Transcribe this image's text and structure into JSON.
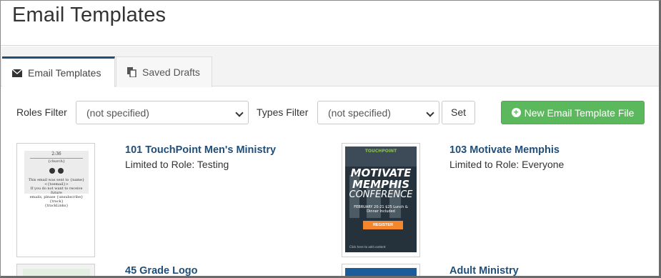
{
  "page": {
    "title": "Email Templates"
  },
  "tabs": [
    {
      "label": "Email Templates",
      "icon": "envelope-icon",
      "active": true
    },
    {
      "label": "Saved Drafts",
      "icon": "copy-icon",
      "active": false
    }
  ],
  "filters": {
    "roles_label": "Roles Filter",
    "roles_value": "(not specified)",
    "types_label": "Types Filter",
    "types_value": "(not specified)",
    "set_label": "Set",
    "new_button_label": "New Email Template File"
  },
  "templates": [
    {
      "name": "101 TouchPoint Men's Ministry",
      "role": "Limited to Role: Testing"
    },
    {
      "name": "103 Motivate Memphis",
      "role": "Limited to Role: Everyone"
    },
    {
      "name": "45 Grade Logo",
      "role": ""
    },
    {
      "name": "Adult Ministry",
      "role": ""
    }
  ],
  "thumb1": {
    "line1": "2:36",
    "line2": "{church}",
    "line3": "This email was sent to {name} <{toemail}>",
    "line4": "If you do not want to receive future",
    "line5": "emails, please {unsubscribe} {track}",
    "line6": "{trackLinks}"
  },
  "thumb2": {
    "brand": "TOUCHPOINT",
    "title1": "MOTIVATE",
    "title2": "MEMPHIS",
    "title3": "CONFERENCE",
    "info": "FEBRUARY 20-21 $25 Lunch & Dinner Included",
    "register": "REGISTER",
    "footer": "Click here to add content"
  },
  "colors": {
    "accent": "#1f4e79",
    "success": "#5cb85c",
    "poster_orange": "#f5862b"
  }
}
